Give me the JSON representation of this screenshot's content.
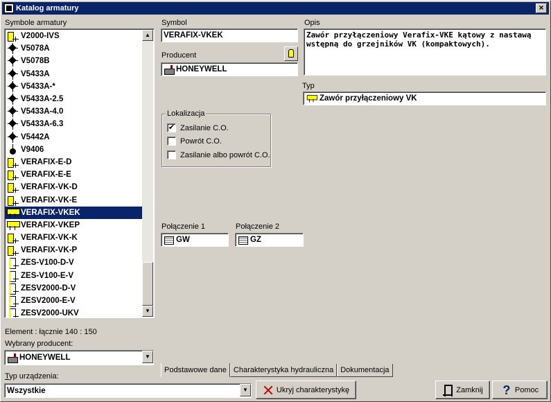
{
  "window": {
    "title": "Katalog armatury"
  },
  "left": {
    "list_label": "Symbole armatury",
    "items": [
      {
        "label": "V2000-IVS",
        "icon": "valve-yellow-icon"
      },
      {
        "label": "V5078A",
        "icon": "valve-diamond-icon"
      },
      {
        "label": "V5078B",
        "icon": "valve-diamond-icon"
      },
      {
        "label": "V5433A",
        "icon": "valve-diamond-icon"
      },
      {
        "label": "V5433A-*",
        "icon": "valve-diamond-icon"
      },
      {
        "label": "V5433A-2.5",
        "icon": "valve-diamond-icon"
      },
      {
        "label": "V5433A-4.0",
        "icon": "valve-diamond-icon"
      },
      {
        "label": "V5433A-6.3",
        "icon": "valve-diamond-icon"
      },
      {
        "label": "V5442A",
        "icon": "valve-diamond-icon"
      },
      {
        "label": "V9406",
        "icon": "valve-dot-icon"
      },
      {
        "label": "VERAFIX-E-D",
        "icon": "valve-yellow-icon"
      },
      {
        "label": "VERAFIX-E-E",
        "icon": "valve-yellow-icon"
      },
      {
        "label": "VERAFIX-VK-D",
        "icon": "valve-yellow-icon"
      },
      {
        "label": "VERAFIX-VK-E",
        "icon": "valve-yellow-icon"
      },
      {
        "label": "VERAFIX-VKEK",
        "icon": "valve-yellow-big-icon",
        "selected": true
      },
      {
        "label": "VERAFIX-VKEP",
        "icon": "valve-yellow-big-icon"
      },
      {
        "label": "VERAFIX-VK-K",
        "icon": "valve-yellow-icon"
      },
      {
        "label": "VERAFIX-VK-P",
        "icon": "valve-yellow-icon"
      },
      {
        "label": "ZES-V100-D-V",
        "icon": "valve-zes-icon"
      },
      {
        "label": "ZES-V100-E-V",
        "icon": "valve-zes-icon"
      },
      {
        "label": "ZESV2000-D-V",
        "icon": "valve-zes-icon"
      },
      {
        "label": "ZESV2000-E-V",
        "icon": "valve-zes-icon"
      },
      {
        "label": "ZESV2000-UKV",
        "icon": "valve-zes-icon"
      }
    ],
    "element_count": "Element : łącznie  140 : 150",
    "producer_label": "Wybrany producent:",
    "producer_value": "HONEYWELL",
    "device_type_label": "Typ urządzenia:",
    "device_type_value": "Wszystkie"
  },
  "detail": {
    "symbol_label": "Symbol",
    "symbol_value": "VERAFIX-VKEK",
    "producer_label": "Producent",
    "producer_value": "HONEYWELL",
    "description_label": "Opis",
    "description_value": "Zawór przyłączeniowy Verafix-VKE kątowy z nastawą wstępną do grzejników VK (kompaktowych).",
    "type_label": "Typ",
    "type_value": "Zawór przyłączeniowy VK",
    "location_group_label": "Lokalizacja",
    "location_options": [
      {
        "label": "Zasilanie C.O.",
        "checked": true
      },
      {
        "label": "Powrót C.O.",
        "checked": false
      },
      {
        "label": "Zasilanie albo powrót C.O.",
        "checked": false
      }
    ],
    "connection1_label": "Połączenie 1",
    "connection1_value": "GW",
    "connection2_label": "Połączenie 2",
    "connection2_value": "GZ"
  },
  "tabs": [
    "Podstawowe dane",
    "Charakterystyka hydrauliczna",
    "Dokumentacja"
  ],
  "buttons": {
    "hide_chart": "Ukryj charakterystykę",
    "close": "Zamknij",
    "help": "Pomoc"
  }
}
